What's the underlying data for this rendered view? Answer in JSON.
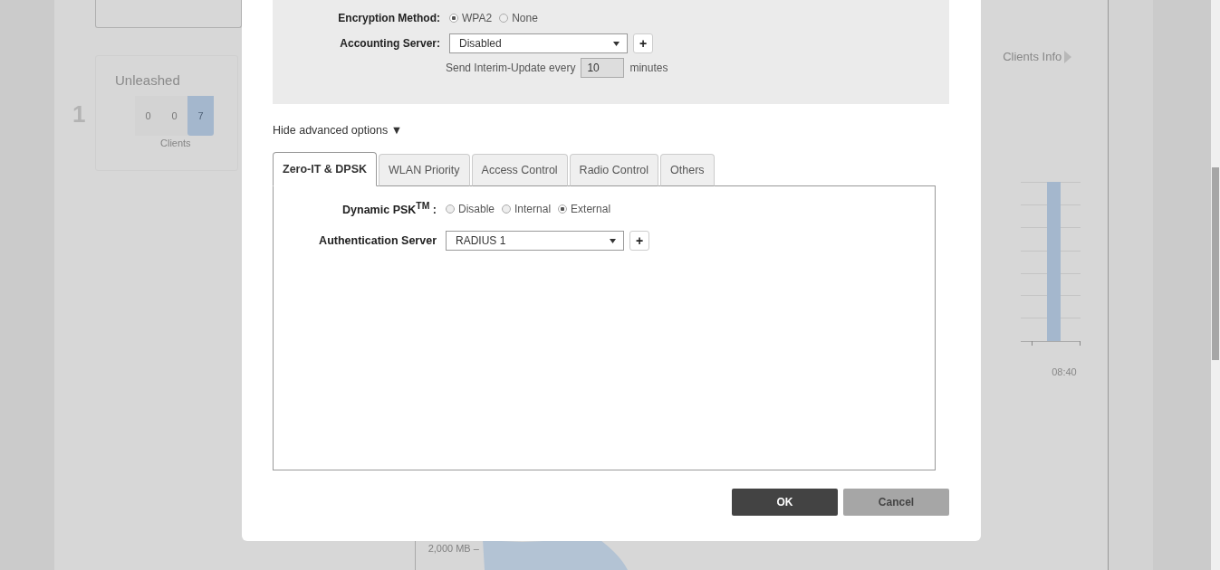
{
  "background": {
    "site_count": "1",
    "card_title": "Unleashed",
    "client_counts": [
      {
        "value": "0",
        "selected": false
      },
      {
        "value": "0",
        "selected": false
      },
      {
        "value": "7",
        "selected": true
      }
    ],
    "clients_label": "Clients",
    "clients_info_link": "Clients Info",
    "chart_time_label": "08:40",
    "traffic_axis_label": "2,000 MB –"
  },
  "dialog": {
    "encryption": {
      "label": "Encryption Method:",
      "options": [
        {
          "label": "WPA2",
          "selected": true
        },
        {
          "label": "None",
          "selected": false
        }
      ]
    },
    "accounting_server": {
      "label": "Accounting Server:",
      "value": "Disabled",
      "add_label": "+",
      "interim_prefix": "Send Interim-Update every",
      "interim_value": "10",
      "interim_suffix": "minutes"
    },
    "advanced_toggle": {
      "label": "Hide advanced options",
      "icon": "▼"
    },
    "tabs": [
      {
        "label": "Zero-IT & DPSK",
        "selected": true
      },
      {
        "label": "WLAN Priority",
        "selected": false
      },
      {
        "label": "Access Control",
        "selected": false
      },
      {
        "label": "Radio Control",
        "selected": false
      },
      {
        "label": "Others",
        "selected": false
      }
    ],
    "dynamic_psk": {
      "label": "Dynamic PSK$^{TM}$ :",
      "options": [
        {
          "label": "Disable",
          "selected": false
        },
        {
          "label": "Internal",
          "selected": false
        },
        {
          "label": "External",
          "selected": true
        }
      ]
    },
    "authentication_server": {
      "label": "Authentication Server",
      "value": "RADIUS 1",
      "add_label": "+"
    },
    "buttons": [
      {
        "label": "OK",
        "kind": "primary"
      },
      {
        "label": "Cancel",
        "kind": "secondary"
      }
    ]
  }
}
